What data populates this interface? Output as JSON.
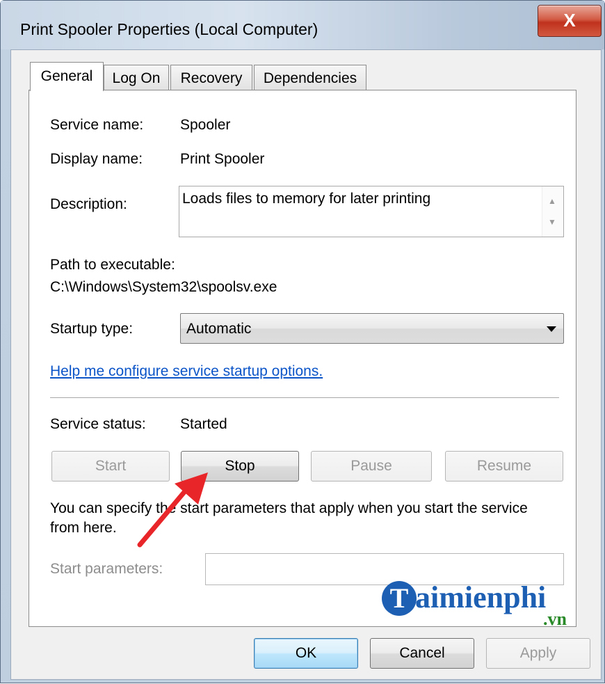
{
  "window": {
    "title": "Print Spooler Properties (Local Computer)",
    "close_label": "X"
  },
  "tabs": [
    {
      "label": "General",
      "active": true
    },
    {
      "label": "Log On",
      "active": false
    },
    {
      "label": "Recovery",
      "active": false
    },
    {
      "label": "Dependencies",
      "active": false
    }
  ],
  "general": {
    "service_name_label": "Service name:",
    "service_name": "Spooler",
    "display_name_label": "Display name:",
    "display_name": "Print Spooler",
    "description_label": "Description:",
    "description": "Loads files to memory for later printing",
    "path_label": "Path to executable:",
    "path": "C:\\Windows\\System32\\spoolsv.exe",
    "startup_type_label": "Startup type:",
    "startup_type": "Automatic",
    "help_link": "Help me configure service startup options.",
    "status_label": "Service status:",
    "status": "Started",
    "buttons": {
      "start": {
        "label": "Start",
        "enabled": false
      },
      "stop": {
        "label": "Stop",
        "enabled": true
      },
      "pause": {
        "label": "Pause",
        "enabled": false
      },
      "resume": {
        "label": "Resume",
        "enabled": false
      }
    },
    "params_info_line1": "You can specify the start parameters that apply when you start the service",
    "params_info_line2": "from here.",
    "start_params_label": "Start parameters:",
    "start_params_value": ""
  },
  "footer": {
    "ok": "OK",
    "cancel": "Cancel",
    "apply": "Apply"
  },
  "watermark": {
    "logo": "T",
    "text": "aimienphi",
    "suffix": ".vn"
  },
  "colors": {
    "link": "#0c55c8",
    "annotation_arrow": "#e8262a",
    "watermark": "#1d5fb3"
  }
}
